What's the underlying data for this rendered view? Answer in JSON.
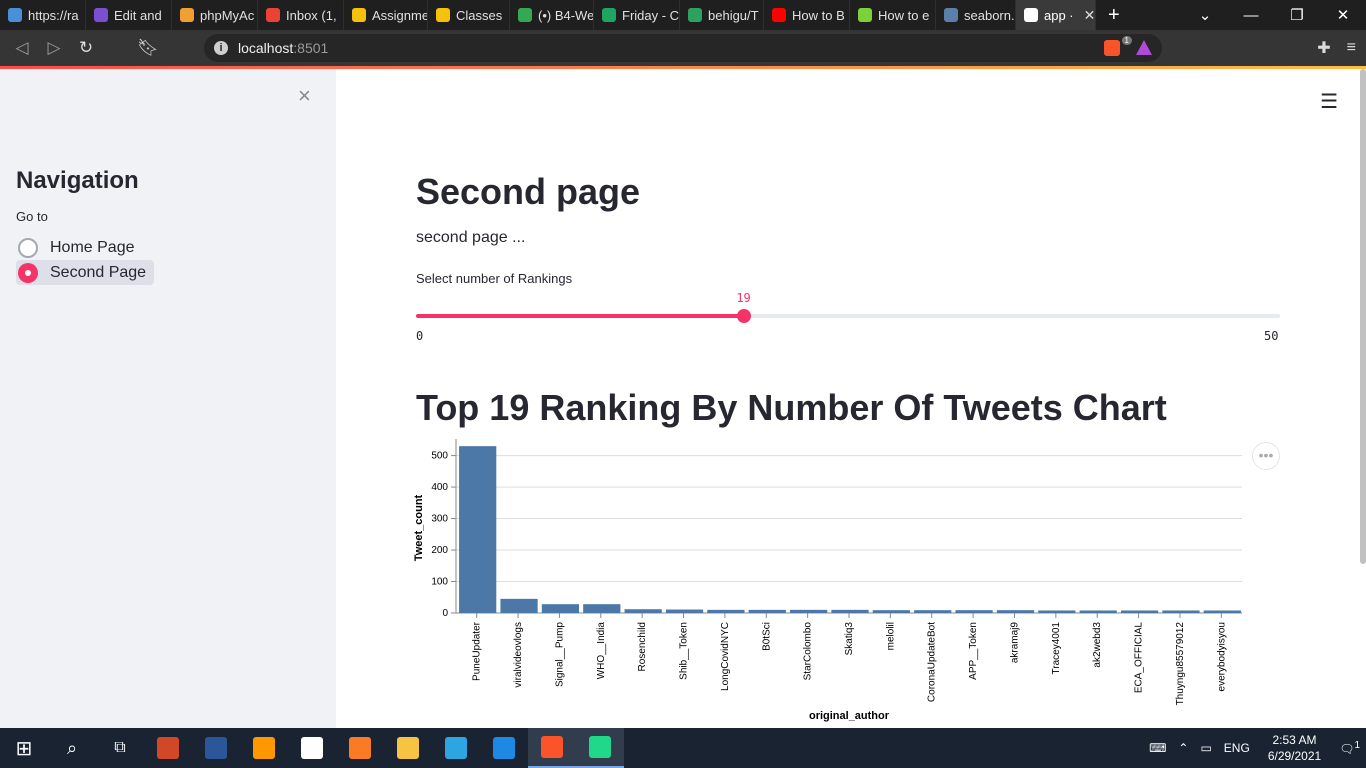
{
  "browser": {
    "tabs": [
      {
        "label": "https://ra",
        "color": "#4a90d9"
      },
      {
        "label": "Edit and",
        "color": "#7b4fd1"
      },
      {
        "label": "phpMyAc",
        "color": "#f0a030"
      },
      {
        "label": "Inbox (1,",
        "color": "#ea4335"
      },
      {
        "label": "Assignme",
        "color": "#f4c20d"
      },
      {
        "label": "Classes",
        "color": "#f4c20d"
      },
      {
        "label": "(•) B4-We",
        "color": "#34a853"
      },
      {
        "label": "Friday - C",
        "color": "#1fa463"
      },
      {
        "label": "behigu/T",
        "color": "#2da160"
      },
      {
        "label": "How to B",
        "color": "#ff0000"
      },
      {
        "label": "How to e",
        "color": "#7bd13a"
      },
      {
        "label": "seaborn.",
        "color": "#5a7fa8"
      },
      {
        "label": "app ·",
        "color": "#ffffff"
      }
    ],
    "new_tab": "+",
    "url_host": "localhost",
    "url_port": ":8501",
    "brave_badge": "1"
  },
  "sidebar": {
    "close": "×",
    "title": "Navigation",
    "goto_label": "Go to",
    "options": [
      {
        "label": "Home Page",
        "selected": false
      },
      {
        "label": "Second Page",
        "selected": true
      }
    ]
  },
  "main": {
    "menu": "☰",
    "title": "Second page",
    "text": "second page ...",
    "slider": {
      "label": "Select number of Rankings",
      "value": 19,
      "min": 0,
      "max": 50,
      "value_text": "19",
      "min_text": "0",
      "max_text": "50"
    },
    "chart_title": "Top 19 Ranking By Number Of Tweets Chart",
    "chart_menu": "•••"
  },
  "chart_data": {
    "type": "bar",
    "title": "",
    "xlabel": "original_author",
    "ylabel": "Tweet_count",
    "ylim": [
      0,
      540
    ],
    "yticks": [
      0,
      100,
      200,
      300,
      400,
      500
    ],
    "grid": true,
    "color": "#4c78a8",
    "categories": [
      "PuneUpdater",
      "viralvideovlogs",
      "Signal__Pump",
      "WHO__India",
      "Rosenchild",
      "Shib__Token",
      "LongCovidNYC",
      "B0tSci",
      "StarColombo",
      "Skatiq3",
      "melolil",
      "CoronaUpdateBot",
      "APP__Token",
      "akramaj9",
      "Tracey4001",
      "ak2webd3",
      "ECA_OFFICIAL",
      "Thuyngu85579012",
      "everybodyisyou"
    ],
    "values": [
      530,
      45,
      28,
      28,
      12,
      11,
      10,
      10,
      10,
      10,
      9,
      9,
      9,
      9,
      8,
      8,
      8,
      8,
      8
    ]
  },
  "taskbar": {
    "apps": [
      {
        "name": "powerpoint",
        "color": "#d24726"
      },
      {
        "name": "word",
        "color": "#2b579a"
      },
      {
        "name": "sublime",
        "color": "#ff9800"
      },
      {
        "name": "chrome-like",
        "color": "#ffffff"
      },
      {
        "name": "xampp",
        "color": "#fb7a24"
      },
      {
        "name": "explorer",
        "color": "#f6c342"
      },
      {
        "name": "telegram",
        "color": "#2ca5e0"
      },
      {
        "name": "vscode",
        "color": "#1e88e5"
      },
      {
        "name": "brave",
        "color": "#fb542b"
      },
      {
        "name": "pycharm",
        "color": "#21d789"
      }
    ],
    "lang": "ENG",
    "time": "2:53 AM",
    "date": "6/29/2021",
    "notif_count": "1"
  }
}
